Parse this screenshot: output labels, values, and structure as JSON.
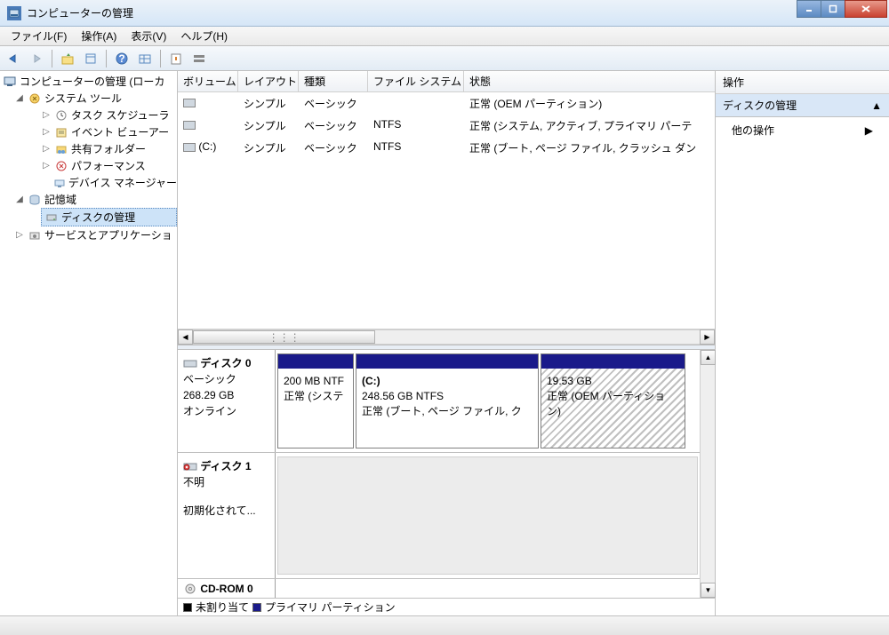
{
  "window": {
    "title": "コンピューターの管理",
    "controls": {
      "min": "–",
      "max": "□",
      "close": "×"
    }
  },
  "menu": {
    "file": "ファイル(F)",
    "action": "操作(A)",
    "view": "表示(V)",
    "help": "ヘルプ(H)"
  },
  "toolbar_icons": {
    "back": "←",
    "forward": "→",
    "up": "⇧",
    "show": "▦",
    "help": "?",
    "refresh": "⟳",
    "export": "⎋",
    "dlist": "☰",
    "dmap": "▤"
  },
  "tree": {
    "root": "コンピューターの管理 (ローカ",
    "system_tools": "システム ツール",
    "task_scheduler": "タスク スケジューラ",
    "event_viewer": "イベント ビューアー",
    "shared_folders": "共有フォルダー",
    "performance": "パフォーマンス",
    "device_manager": "デバイス マネージャー",
    "storage": "記憶域",
    "disk_management": "ディスクの管理",
    "services_apps": "サービスとアプリケーショ"
  },
  "vol_headers": {
    "volume": "ボリューム",
    "layout": "レイアウト",
    "type": "種類",
    "fs": "ファイル システム",
    "status": "状態"
  },
  "volumes": [
    {
      "name": "",
      "layout": "シンプル",
      "type": "ベーシック",
      "fs": "",
      "status": "正常 (OEM パーティション)"
    },
    {
      "name": "",
      "layout": "シンプル",
      "type": "ベーシック",
      "fs": "NTFS",
      "status": "正常 (システム, アクティブ, プライマリ パーテ"
    },
    {
      "name": "(C:)",
      "layout": "シンプル",
      "type": "ベーシック",
      "fs": "NTFS",
      "status": "正常 (ブート, ページ ファイル, クラッシュ ダン"
    }
  ],
  "disks": {
    "disk0": {
      "name": "ディスク 0",
      "type": "ベーシック",
      "size": "268.29 GB",
      "status": "オンライン",
      "parts": [
        {
          "label": "",
          "size": "200 MB NTF",
          "status": "正常 (システ",
          "kind": "primary",
          "width": "86"
        },
        {
          "label": "(C:)",
          "size": "248.56 GB NTFS",
          "status": "正常 (ブート, ページ ファイル, ク",
          "kind": "primary",
          "width": "208"
        },
        {
          "label": "",
          "size": "19.53 GB",
          "status": "正常 (OEM パーティション)",
          "kind": "oem",
          "width": "160"
        }
      ]
    },
    "disk1": {
      "name": "ディスク 1",
      "type": "不明",
      "status": "初期化されて..."
    },
    "cdrom": {
      "name": "CD-ROM 0"
    }
  },
  "legend": {
    "unalloc": "未割り当て",
    "primary": "プライマリ パーティション"
  },
  "actions": {
    "header": "操作",
    "disk_mgmt": "ディスクの管理",
    "other": "他の操作"
  }
}
